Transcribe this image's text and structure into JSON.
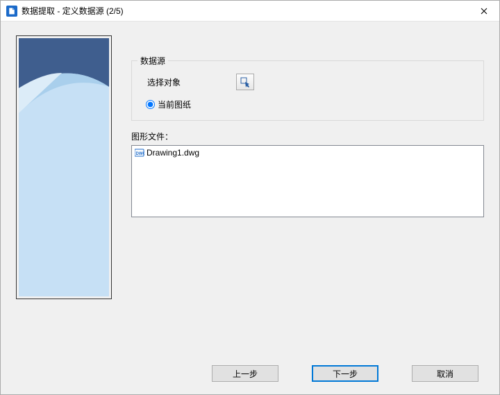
{
  "window": {
    "title": "数据提取 - 定义数据源 (2/5)"
  },
  "dataSource": {
    "legend": "数据源",
    "selectObjectsLabel": "选择对象",
    "currentDrawingLabel": "当前图纸"
  },
  "files": {
    "label": "图形文件：",
    "items": [
      {
        "name": "Drawing1.dwg"
      }
    ]
  },
  "buttons": {
    "back": "上一步",
    "next": "下一步",
    "cancel": "取消"
  }
}
